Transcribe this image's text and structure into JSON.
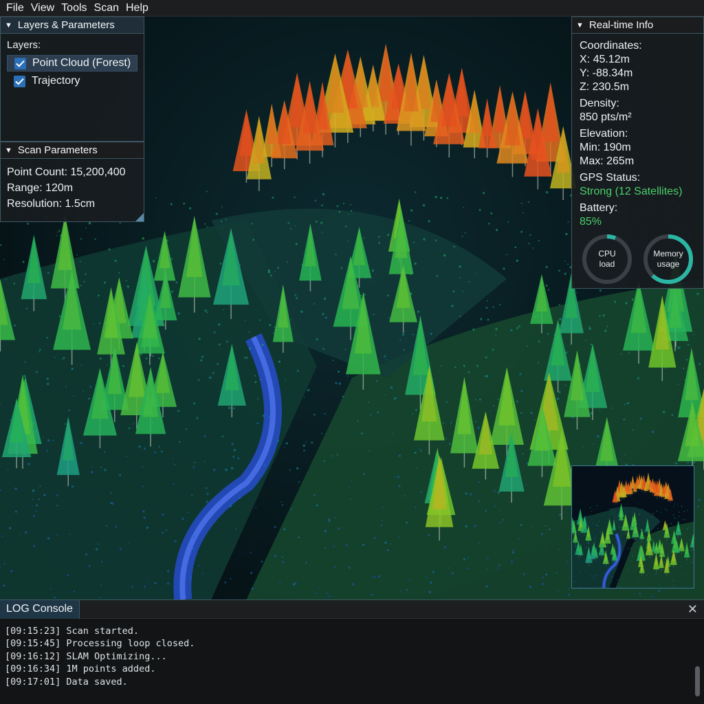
{
  "menu": [
    "File",
    "View",
    "Tools",
    "Scan",
    "Help"
  ],
  "layers_panel": {
    "title": "Layers & Parameters",
    "layers_label": "Layers:",
    "layers": [
      {
        "label": "Point Cloud (Forest)",
        "checked": true,
        "selected": true
      },
      {
        "label": "Trajectory",
        "checked": true,
        "selected": false
      }
    ]
  },
  "scan_panel": {
    "title": "Scan Parameters",
    "point_count": "Point Count: 15,200,400",
    "range": "Range: 120m",
    "resolution": "Resolution: 1.5cm"
  },
  "info_panel": {
    "title": "Real-time Info",
    "coordinates_label": "Coordinates:",
    "x": "X: 45.12m",
    "y": "Y: -88.34m",
    "z": "Z: 230.5m",
    "density_label": "Density:",
    "density": "850 pts/m²",
    "elevation_label": "Elevation:",
    "elev_min": "Min: 190m",
    "elev_max": "Max: 265m",
    "gps_label": "GPS Status:",
    "gps_value": "Strong (12 Satellites)",
    "battery_label": "Battery:",
    "battery_value": "85%",
    "cpu_label_1": "CPU",
    "cpu_label_2": "load",
    "cpu_level": 0.06,
    "memory_label_1": "Memory",
    "memory_label_2": "usage",
    "memory_level": 0.62
  },
  "console": {
    "tab": "LOG Console",
    "close_symbol": "✕",
    "lines": [
      "[09:15:23] Scan started.",
      "[09:15:45] Processing loop closed.",
      "[09:16:12] SLAM Optimizing...",
      "[09:16:34] 1M points added.",
      "[09:17:01] Data saved."
    ]
  },
  "colors": {
    "accent": "#2a6fb8",
    "status_green": "#4cd06a",
    "gauge_teal": "#2bb6a4",
    "panel_border": "#3f5864"
  },
  "icons": [
    "collapse-triangle-icon",
    "checkmark-icon",
    "close-icon"
  ]
}
